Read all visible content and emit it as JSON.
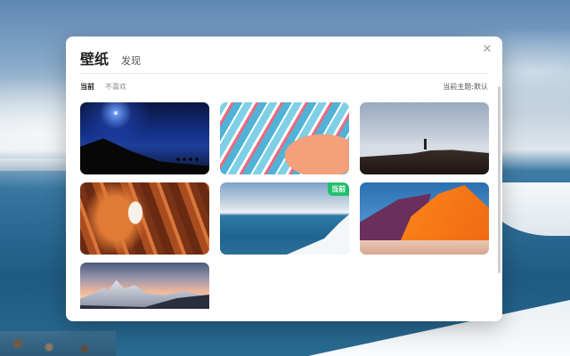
{
  "dialog": {
    "title": "壁纸",
    "header_tab": "发现",
    "close_glyph": "✕",
    "subtabs": [
      "当前",
      "不喜欢"
    ],
    "active_subtab": "当前",
    "current_theme_label": "当前主题:",
    "current_theme_value": "默认",
    "current_badge": "当前",
    "accent_color": "#22c06b"
  },
  "wallpapers": [
    {
      "id": "night-sky-hikers"
    },
    {
      "id": "marble-swirl"
    },
    {
      "id": "dune-figure"
    },
    {
      "id": "antelope-canyon"
    },
    {
      "id": "frozen-lake",
      "current": true
    },
    {
      "id": "orange-dune"
    },
    {
      "id": "mountain-sunset"
    }
  ]
}
